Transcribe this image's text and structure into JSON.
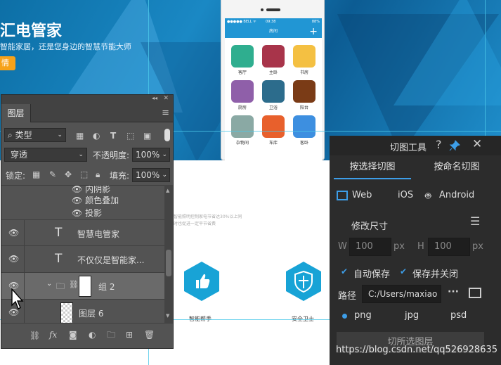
{
  "canvas": {
    "hero_title": "汇电管家",
    "hero_subtitle": "智能家居，还是您身边的智慧节能大师",
    "hero_button": "情",
    "phone": {
      "status_left": "●●●●● BELL ᯤ",
      "status_center": "09:38",
      "status_right": "88%",
      "nav_title": "房间",
      "nav_plus": "+",
      "apps": [
        {
          "label": "客厅",
          "color": "#2fae8f"
        },
        {
          "label": "主卧",
          "color": "#a8344a"
        },
        {
          "label": "书房",
          "color": "#f4c042"
        },
        {
          "label": "厨房",
          "color": "#8f5fa9"
        },
        {
          "label": "卫浴",
          "color": "#2c6c8c"
        },
        {
          "label": "阳台",
          "color": "#7a3b16"
        },
        {
          "label": "杂物间",
          "color": "#8aa9a4"
        },
        {
          "label": "车库",
          "color": "#e8602c"
        },
        {
          "label": "客卧",
          "color": "#3d8fe0"
        }
      ]
    },
    "feature_desc": "智能照明控制家电节省达30%以上同时也促进一定平节省费",
    "features": [
      {
        "label": "智能帮手",
        "icon": "thumbs-up-icon"
      },
      {
        "label": "安全卫士",
        "icon": "shield-icon"
      }
    ]
  },
  "layers_panel": {
    "collapse": "◂◂",
    "close": "✕",
    "tab": "图层",
    "menu": "≡",
    "filter_label": "类型",
    "blend_mode": "穿透",
    "opacity_label": "不透明度:",
    "opacity_value": "100%",
    "lock_label": "锁定:",
    "fill_label": "填充:",
    "fill_value": "100%",
    "effects": [
      "内阴影",
      "颜色叠加",
      "投影"
    ],
    "layers": [
      {
        "name": "智慧电管家",
        "type": "T"
      },
      {
        "name": "不仅仅是智能家...",
        "type": "T"
      },
      {
        "name": "组 2",
        "type": "group"
      },
      {
        "name": "图层 6",
        "type": "pixel"
      }
    ],
    "bottom_fx": "fx"
  },
  "cut_panel": {
    "title": "切图工具",
    "help": "?",
    "close": "✕",
    "tab_select": "按选择切图",
    "tab_name": "按命名切图",
    "platforms": [
      "Web",
      "iOS",
      "Android"
    ],
    "resize_label": "修改尺寸",
    "w_label": "W",
    "w_value": "100",
    "w_unit": "px",
    "h_label": "H",
    "h_value": "100",
    "h_unit": "px",
    "auto_save": "自动保存",
    "save_close": "保存并关闭",
    "path_label": "路径",
    "path_value": "C:/Users/maxiao",
    "path_more": "···",
    "formats": [
      "png",
      "jpg",
      "psd"
    ],
    "cut_button": "切所选图层"
  },
  "watermark": "https://blog.csdn.net/qq526928635"
}
